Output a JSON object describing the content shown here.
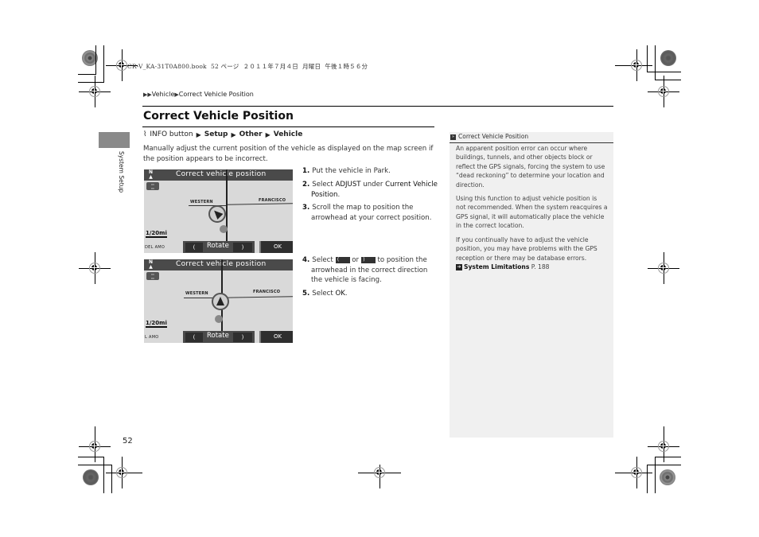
{
  "print_header": "CR-V_KA-31T0A800.book  52 ページ  ２０１１年７月４日  月曜日  午後１時５６分",
  "breadcrumb": {
    "separator_icon": "double-triangle-right",
    "items": [
      "Vehicle",
      "Correct Vehicle Position"
    ]
  },
  "side_tab": {
    "label": "System Setup"
  },
  "page": {
    "title": "Correct Vehicle Position",
    "nav_path": {
      "icon": "info-button-icon",
      "items": [
        "INFO button",
        "Setup",
        "Other",
        "Vehicle"
      ]
    },
    "intro": "Manually adjust the current position of the vehicle as displayed on the map screen if the position appears to be incorrect.",
    "steps": [
      {
        "num": "1.",
        "parts": [
          {
            "t": "Put the vehicle in Park."
          }
        ]
      },
      {
        "num": "2.",
        "parts": [
          {
            "t": "Select "
          },
          {
            "t": "ADJUST",
            "b": true
          },
          {
            "t": " under "
          },
          {
            "t": "Current Vehicle Position",
            "b": true
          },
          {
            "t": "."
          }
        ]
      },
      {
        "num": "3.",
        "parts": [
          {
            "t": "Scroll the map to position the arrowhead at your correct position."
          }
        ]
      },
      {
        "num": "4.",
        "parts": [
          {
            "t": "Select "
          },
          {
            "btn": "("
          },
          {
            "t": " or "
          },
          {
            "btn": ")"
          },
          {
            "t": " to position the arrowhead in the correct direction the vehicle is facing."
          }
        ]
      },
      {
        "num": "5.",
        "parts": [
          {
            "t": "Select "
          },
          {
            "t": "OK",
            "b": true
          },
          {
            "t": "."
          }
        ]
      }
    ],
    "page_number": "52"
  },
  "screens": [
    {
      "title": "Correct vehicle position",
      "north_label": "N",
      "street_left": "WESTERN",
      "street_right": "FRANCISCO",
      "scale": "1/20mi",
      "locality": "DEL AMO",
      "rotate_label": "Rotate",
      "rotate_left": "(",
      "rotate_right": ")",
      "ok_label": "OK",
      "arrow_heading": "north-west"
    },
    {
      "title": "Correct vehicle position",
      "north_label": "N",
      "street_left": "WESTERN",
      "street_right": "FRANCISCO",
      "scale": "1/20mi",
      "locality": "L AMO",
      "rotate_label": "Rotate",
      "rotate_left": "(",
      "rotate_right": ")",
      "ok_label": "OK",
      "arrow_heading": "north"
    }
  ],
  "note": {
    "heading": "Correct Vehicle Position",
    "paragraphs": [
      "An apparent position error can occur where buildings, tunnels, and other objects block or reflect the GPS signals, forcing the system to use “dead reckoning” to determine your location and direction.",
      "Using this function to adjust vehicle position is not recommended. When the system reacquires a GPS signal, it will automatically place the vehicle in the correct location.",
      "If you continually have to adjust the vehicle position, you may have problems with the GPS reception or there may be database errors."
    ],
    "link": {
      "label": "System Limitations",
      "page": "P. 188"
    }
  },
  "colors": {
    "side_tab": "#8a8a8a",
    "note_bg": "#f0f0f0",
    "screen_bar": "#4a4a4a",
    "map_bg": "#d9d9d9"
  }
}
